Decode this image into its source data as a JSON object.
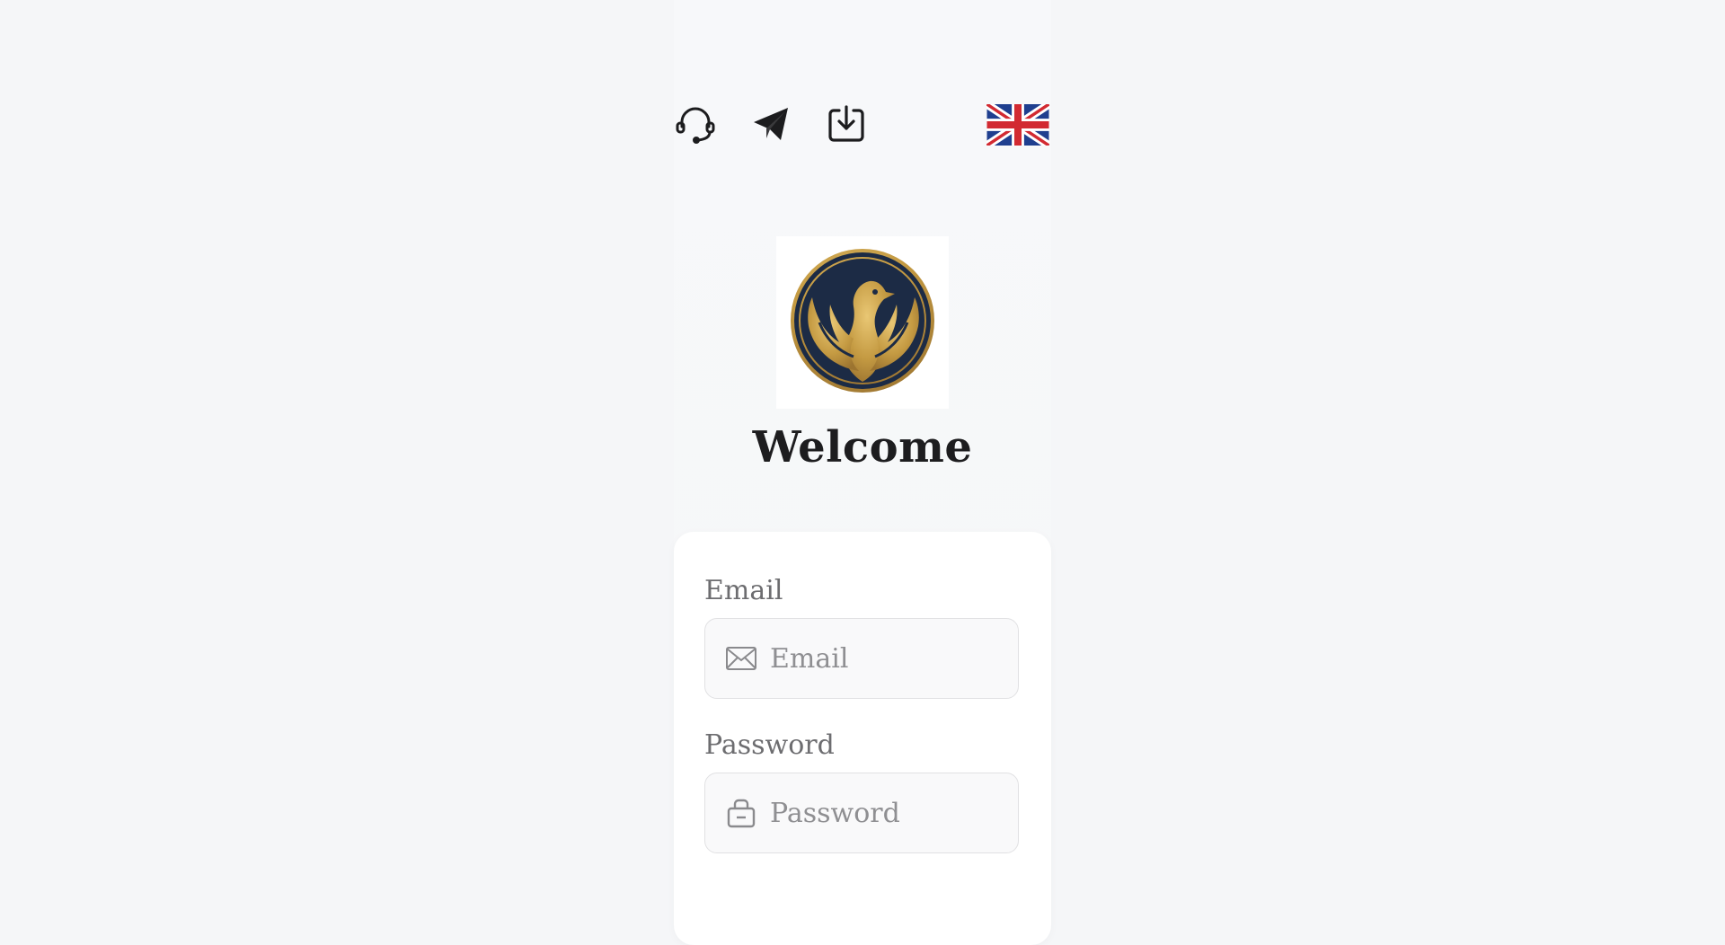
{
  "header": {
    "icons": [
      {
        "name": "support-headset-icon"
      },
      {
        "name": "telegram-icon"
      },
      {
        "name": "download-icon"
      }
    ],
    "language_flag": "uk-flag-icon"
  },
  "brand": {
    "logo": "eagle-emblem",
    "colors": {
      "navy": "#1c2b45",
      "gold": "#c9a24a"
    }
  },
  "welcome": {
    "title": "Welcome"
  },
  "form": {
    "email": {
      "label": "Email",
      "placeholder": "Email",
      "value": ""
    },
    "password": {
      "label": "Password",
      "placeholder": "Password",
      "value": ""
    }
  }
}
